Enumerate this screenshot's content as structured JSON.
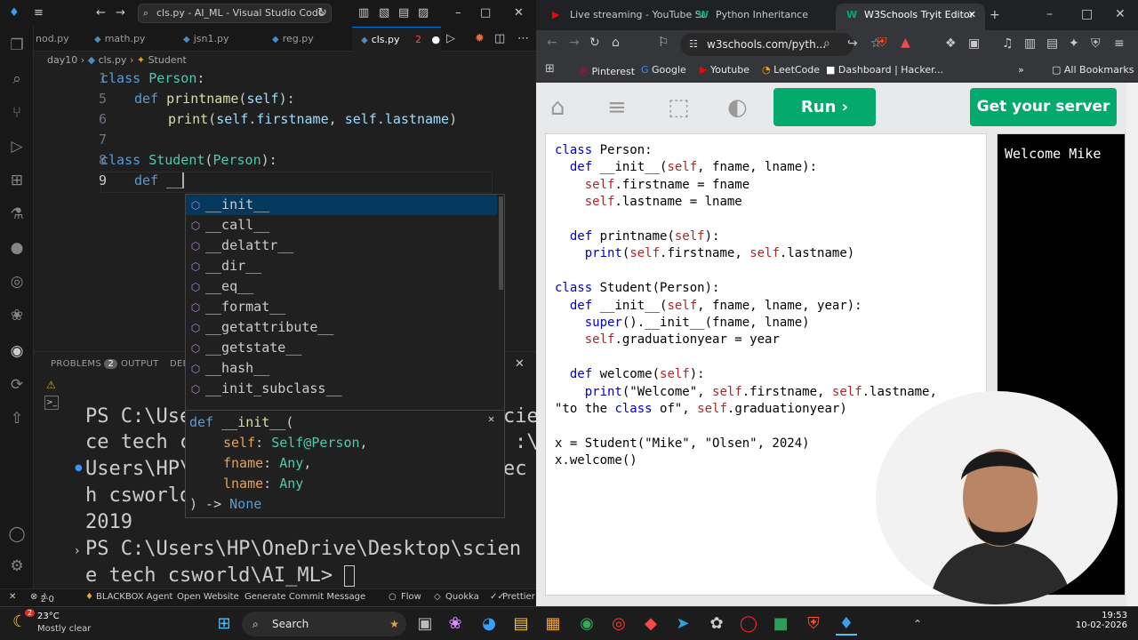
{
  "vscode": {
    "window_title": "cls.py - AI_ML - Visual Studio Code",
    "tabs": [
      {
        "label": "nod.py"
      },
      {
        "label": "math.py"
      },
      {
        "label": "jsn1.py"
      },
      {
        "label": "reg.py"
      },
      {
        "label": "cls.py",
        "badge": "2"
      }
    ],
    "breadcrumb": {
      "folder": "day10",
      "file": "cls.py",
      "symbol": "Student"
    },
    "line_numbers": [
      "1",
      "5",
      "6",
      "7",
      "8",
      "9"
    ],
    "code_lines": [
      [
        "class",
        " ",
        "Person",
        ":"
      ],
      [
        "def",
        " ",
        "printname",
        "(",
        "self",
        "):"
      ],
      [
        "print",
        "(",
        "self",
        ".",
        "firstname",
        ", ",
        "self",
        ".",
        "lastname",
        ")"
      ],
      [],
      [
        "class",
        " ",
        "Student",
        "(",
        "Person",
        "):"
      ],
      [
        "def",
        " ",
        "__"
      ]
    ],
    "suggestions": [
      "__init__",
      "__call__",
      "__delattr__",
      "__dir__",
      "__eq__",
      "__format__",
      "__getattribute__",
      "__getstate__",
      "__hash__",
      "__init_subclass__"
    ],
    "signature": {
      "line1": [
        "def",
        " ",
        "__init__",
        "("
      ],
      "line2": [
        "self",
        ": ",
        "Self@Person",
        ","
      ],
      "line3": [
        "fname",
        ": ",
        "Any",
        ","
      ],
      "line4": [
        "lname",
        ": ",
        "Any"
      ],
      "line5": [
        ") -> ",
        "None"
      ]
    },
    "panel_tabs": {
      "problems": "PROBLEMS",
      "problems_count": "2",
      "output": "OUTPUT",
      "debug": "DEBU"
    },
    "terminal_lines": [
      "PS C:\\Use",
      "ce tech c",
      "Users\\HP\\",
      "h csworld",
      "2019",
      "PS C:\\Users\\HP\\OneDrive\\Desktop\\scien",
      "e tech csworld\\AI_ML> "
    ],
    "terminal_right": [
      "cien",
      ":\\",
      "ec"
    ],
    "statusbar": {
      "errors": "2",
      "warnings": "0",
      "items": [
        "BLACKBOX Agent",
        "Open Website",
        "Generate Commit Message",
        "Flow",
        "Quokka",
        "Prettier"
      ]
    }
  },
  "chrome": {
    "tabs": [
      {
        "label": "Live streaming - YouTube St",
        "icon": "youtube-icon"
      },
      {
        "label": "Python Inheritance",
        "icon": "w3schools-icon"
      },
      {
        "label": "W3Schools Tryit Editor",
        "icon": "w3schools-icon"
      }
    ],
    "url": "w3schools.com/pyth...",
    "bookmarks": [
      "Pinterest",
      "Google",
      "Youtube",
      "LeetCode",
      "Dashboard | Hacker...",
      "All Bookmarks"
    ],
    "tryit": {
      "run_label": "Run",
      "server_label": "Get your server",
      "code_lines": [
        "class Person:",
        "  def __init__(self, fname, lname):",
        "    self.firstname = fname",
        "    self.lastname = lname",
        "",
        "  def printname(self):",
        "    print(self.firstname, self.lastname)",
        "",
        "class Student(Person):",
        "  def __init__(self, fname, lname, year):",
        "    super().__init__(fname, lname)",
        "    self.graduationyear = year",
        "",
        "  def welcome(self):",
        "    print(\"Welcome\", self.firstname, self.lastname,",
        "\"to the class of\", self.graduationyear)",
        "",
        "x = Student(\"Mike\", \"Olsen\", 2024)",
        "x.welcome()"
      ],
      "output": "Welcome Mike"
    }
  },
  "taskbar": {
    "weather_temp": "23°C",
    "weather_desc": "Mostly clear",
    "weather_badge": "2",
    "search_label": "Search",
    "time": "19:53",
    "date": "10-02-2026"
  },
  "colors": {
    "accent": "#0078d4",
    "w3green": "#04aa6d"
  }
}
